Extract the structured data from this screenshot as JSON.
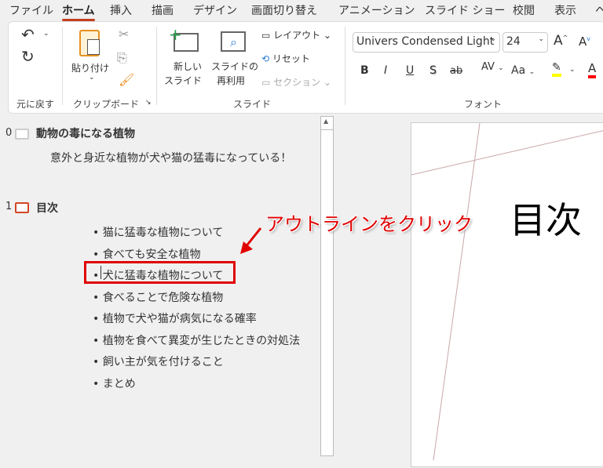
{
  "tabs": [
    "ファイル",
    "ホーム",
    "挿入",
    "描画",
    "デザイン",
    "画面切り替え",
    "アニメーション",
    "スライド ショー",
    "校閲",
    "表示",
    "ヘ"
  ],
  "ribbon": {
    "undo_group": "元に戻す",
    "clipboard": {
      "paste": "貼り付け",
      "group": "クリップボード"
    },
    "slides": {
      "new_slide_1": "新しい",
      "new_slide_2": "スライド",
      "reuse_1": "スライドの",
      "reuse_2": "再利用",
      "layout": "レイアウト",
      "reset": "リセット",
      "section": "セクション",
      "group": "スライド"
    },
    "font": {
      "name": "Univers Condensed Light",
      "size": "24",
      "group": "フォント",
      "bold": "B",
      "italic": "I",
      "underline": "U",
      "shadow": "S",
      "strike": "ab",
      "spacing": "AV",
      "case": "Aa",
      "highlight_color": "#ffff00",
      "font_color": "#ff0000"
    }
  },
  "outline": {
    "slides": [
      {
        "number": "0",
        "title": "動物の毒になる植物",
        "subtitle": "意外と身近な植物が犬や猫の猛毒になっている！"
      },
      {
        "number": "1",
        "title": "目次",
        "bullets": [
          "猫に猛毒な植物について",
          "食べても安全な植物",
          "犬に猛毒な植物について",
          "食べることで危険な植物",
          "植物で犬や猫が病気になる確率",
          "植物を食べて異変が生じたときの対処法",
          "飼い主が気を付けること",
          "まとめ"
        ]
      }
    ]
  },
  "annotation": {
    "text": "アウトラインをクリック",
    "color": "#e00000"
  },
  "slide": {
    "title": "目次"
  }
}
